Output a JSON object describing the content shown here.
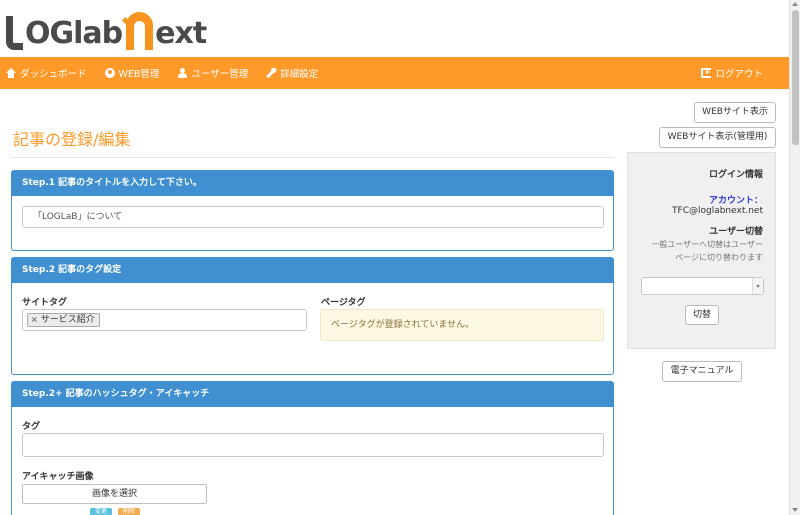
{
  "logo": {
    "text_before": "OGlab",
    "text_after": "ext"
  },
  "nav": {
    "items": [
      {
        "label": "ダッシュボード",
        "icon": "home-icon"
      },
      {
        "label": "WEB管理",
        "icon": "globe-icon"
      },
      {
        "label": "ユーザー管理",
        "icon": "user-icon"
      },
      {
        "label": "詳細設定",
        "icon": "wrench-icon"
      }
    ],
    "logout": "ログアウト"
  },
  "page": {
    "title": "記事の登録/編集"
  },
  "step1": {
    "heading": "Step.1 記事のタイトルを入力して下さい。",
    "title_value": "「LOGLaB」について"
  },
  "step2": {
    "heading": "Step.2 記事のタグ設定",
    "site_tag_label": "サイトタグ",
    "site_tag_chip": "サービス紹介",
    "page_tag_label": "ページタグ",
    "page_tag_notice": "ページタグが登録されていません。"
  },
  "step3": {
    "heading": "Step.2+ 記事のハッシュタグ・アイキャッチ",
    "tag_label": "タグ",
    "tag_value": "",
    "eyecatch_label": "アイキャッチ画像",
    "select_image": "画像を選択",
    "badge1": "変更",
    "badge2": "削除"
  },
  "sidebar": {
    "web_view": "WEBサイト表示",
    "web_view_admin": "WEBサイト表示(管理用)",
    "login_info_title": "ログイン情報",
    "account_label": "アカウント：",
    "account_value": "TFC@loglabnext.net",
    "switch_title": "ユーザー切替",
    "switch_desc_1": "一般ユーザーへ切替はユーザー",
    "switch_desc_2": "ページに切り替わります",
    "switch_select_value": "",
    "switch_button": "切替",
    "manual_button": "電子マニュアル"
  },
  "colors": {
    "accent_orange": "#ff9a2a",
    "panel_blue": "#3f8fd1",
    "account_blue": "#2b3bd6"
  }
}
